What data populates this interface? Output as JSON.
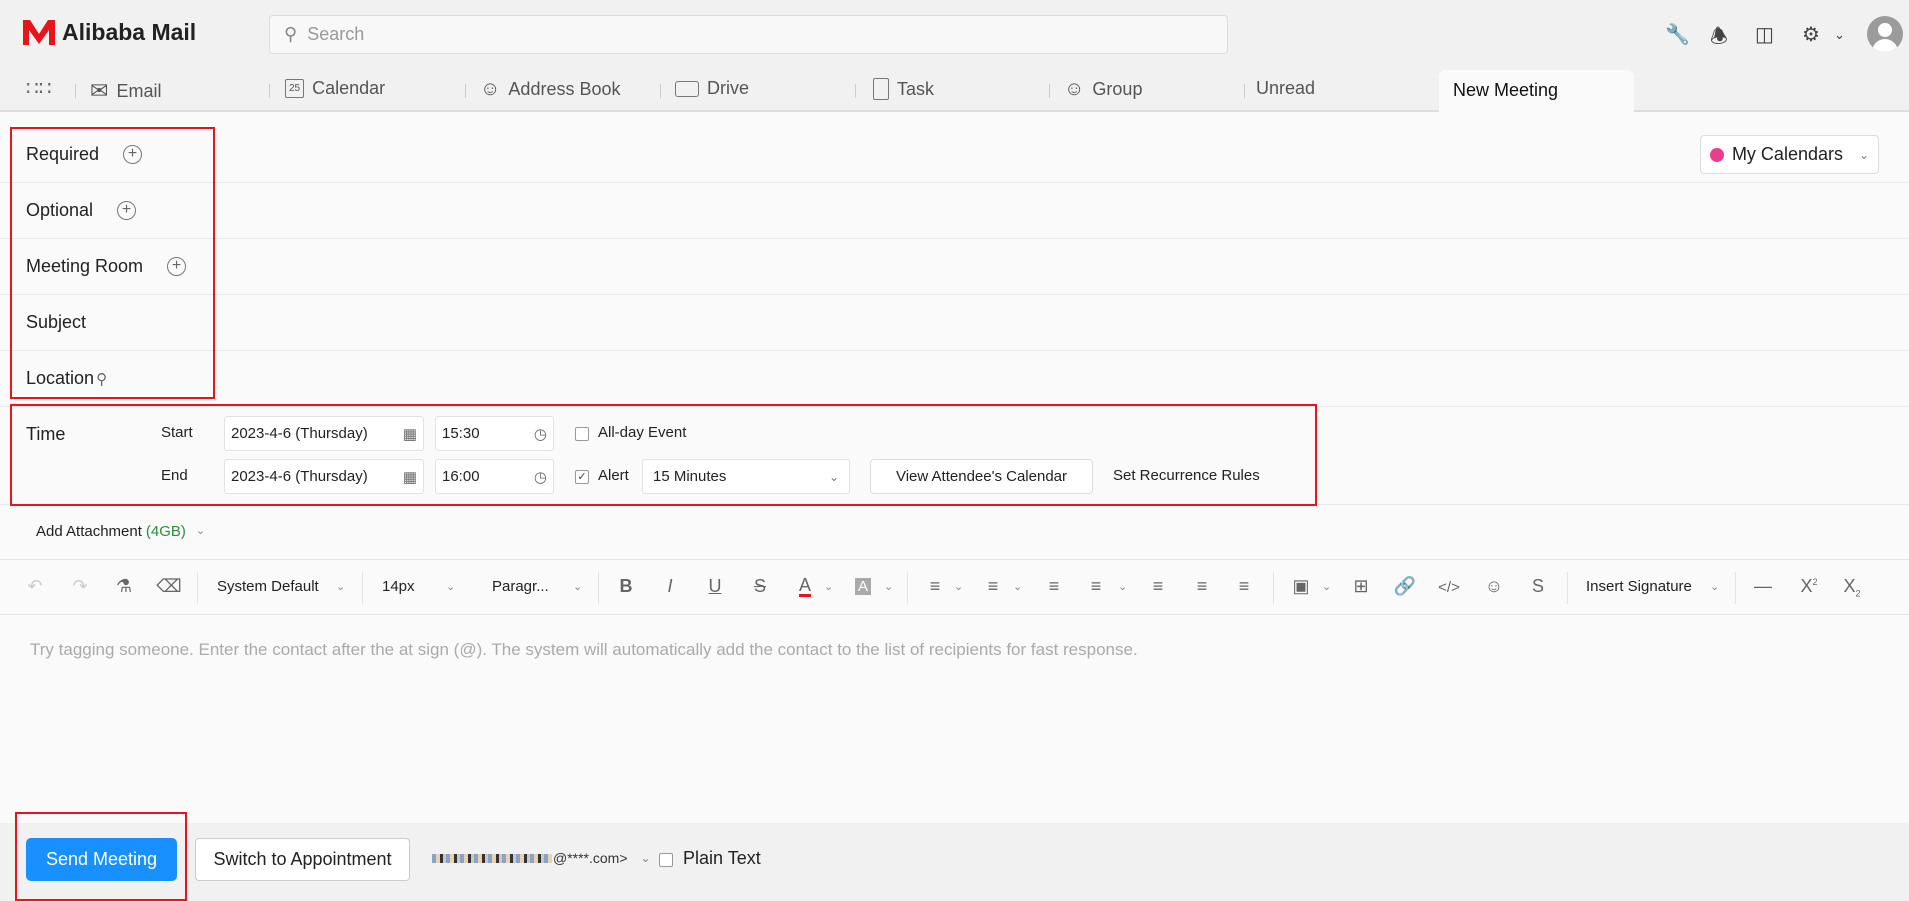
{
  "app": {
    "name": "Alibaba Mail",
    "brand_color": "#e8141b"
  },
  "search": {
    "placeholder": "Search"
  },
  "header_icons": [
    "wrench-icon",
    "bell-icon",
    "devices-icon",
    "gear-icon",
    "chevron-down-icon",
    "avatar"
  ],
  "nav": {
    "tabs": [
      {
        "label": "Email",
        "icon": "envelope-icon"
      },
      {
        "label": "Calendar",
        "icon": "calendar-icon",
        "icon_text": "25"
      },
      {
        "label": "Address Book",
        "icon": "contacts-icon"
      },
      {
        "label": "Drive",
        "icon": "drive-icon"
      },
      {
        "label": "Task",
        "icon": "clipboard-icon"
      },
      {
        "label": "Group",
        "icon": "group-icon"
      },
      {
        "label": "Unread"
      }
    ],
    "active_tab": "New Meeting"
  },
  "form": {
    "required": "Required",
    "optional": "Optional",
    "meeting_room": "Meeting Room",
    "subject": "Subject",
    "location": "Location",
    "calendar_select": "My Calendars",
    "calendar_color": "#e83e8c"
  },
  "time": {
    "label": "Time",
    "start_label": "Start",
    "end_label": "End",
    "start_date": "2023-4-6 (Thursday)",
    "start_time": "15:30",
    "end_date": "2023-4-6 (Thursday)",
    "end_time": "16:00",
    "all_day": {
      "label": "All-day Event",
      "checked": false
    },
    "alert": {
      "label": "Alert",
      "checked": true,
      "value": "15 Minutes"
    },
    "view_calendar": "View Attendee's Calendar",
    "recurrence": "Set Recurrence Rules"
  },
  "attachment": {
    "label": "Add Attachment",
    "size": "(4GB)",
    "size_color": "#2e8b3e"
  },
  "toolbar": {
    "font": "System Default",
    "size": "14px",
    "block": "Paragr...",
    "signature": "Insert Signature"
  },
  "editor": {
    "placeholder": "Try tagging someone. Enter the contact after the at sign (@). The system will automatically add the contact to the list of recipients for fast response."
  },
  "footer": {
    "send": "Send Meeting",
    "switch": "Switch to Appointment",
    "sender_suffix": "@****.com>",
    "plain_text": "Plain Text",
    "plain_text_checked": false,
    "send_color": "#1890ff"
  }
}
